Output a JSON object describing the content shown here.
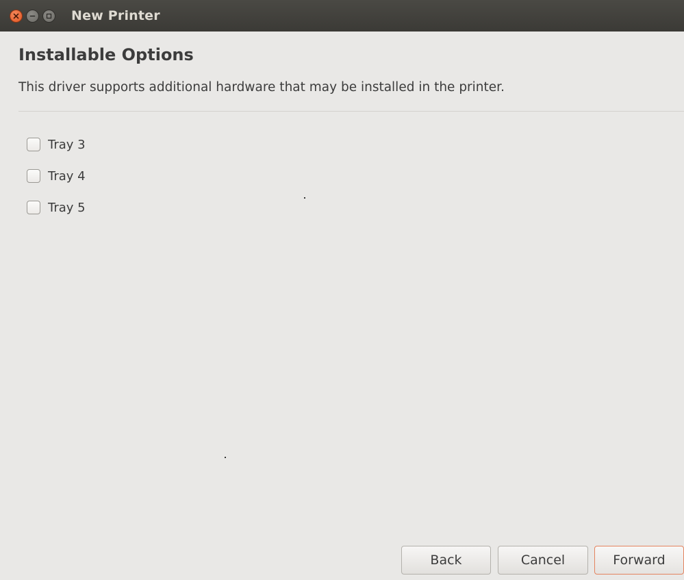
{
  "window": {
    "title": "New Printer",
    "controls": {
      "close": "close-icon",
      "minimize": "minimize-icon",
      "maximize": "maximize-icon"
    }
  },
  "page": {
    "heading": "Installable Options",
    "description": "This driver supports additional hardware that may be installed in the printer."
  },
  "options": [
    {
      "label": "Tray 3",
      "checked": false
    },
    {
      "label": "Tray 4",
      "checked": false
    },
    {
      "label": "Tray 5",
      "checked": false
    }
  ],
  "buttons": {
    "back": "Back",
    "cancel": "Cancel",
    "forward": "Forward"
  },
  "colors": {
    "accent": "#e4835e",
    "titlebar": "#3f3e3a",
    "background": "#e9e8e6"
  }
}
